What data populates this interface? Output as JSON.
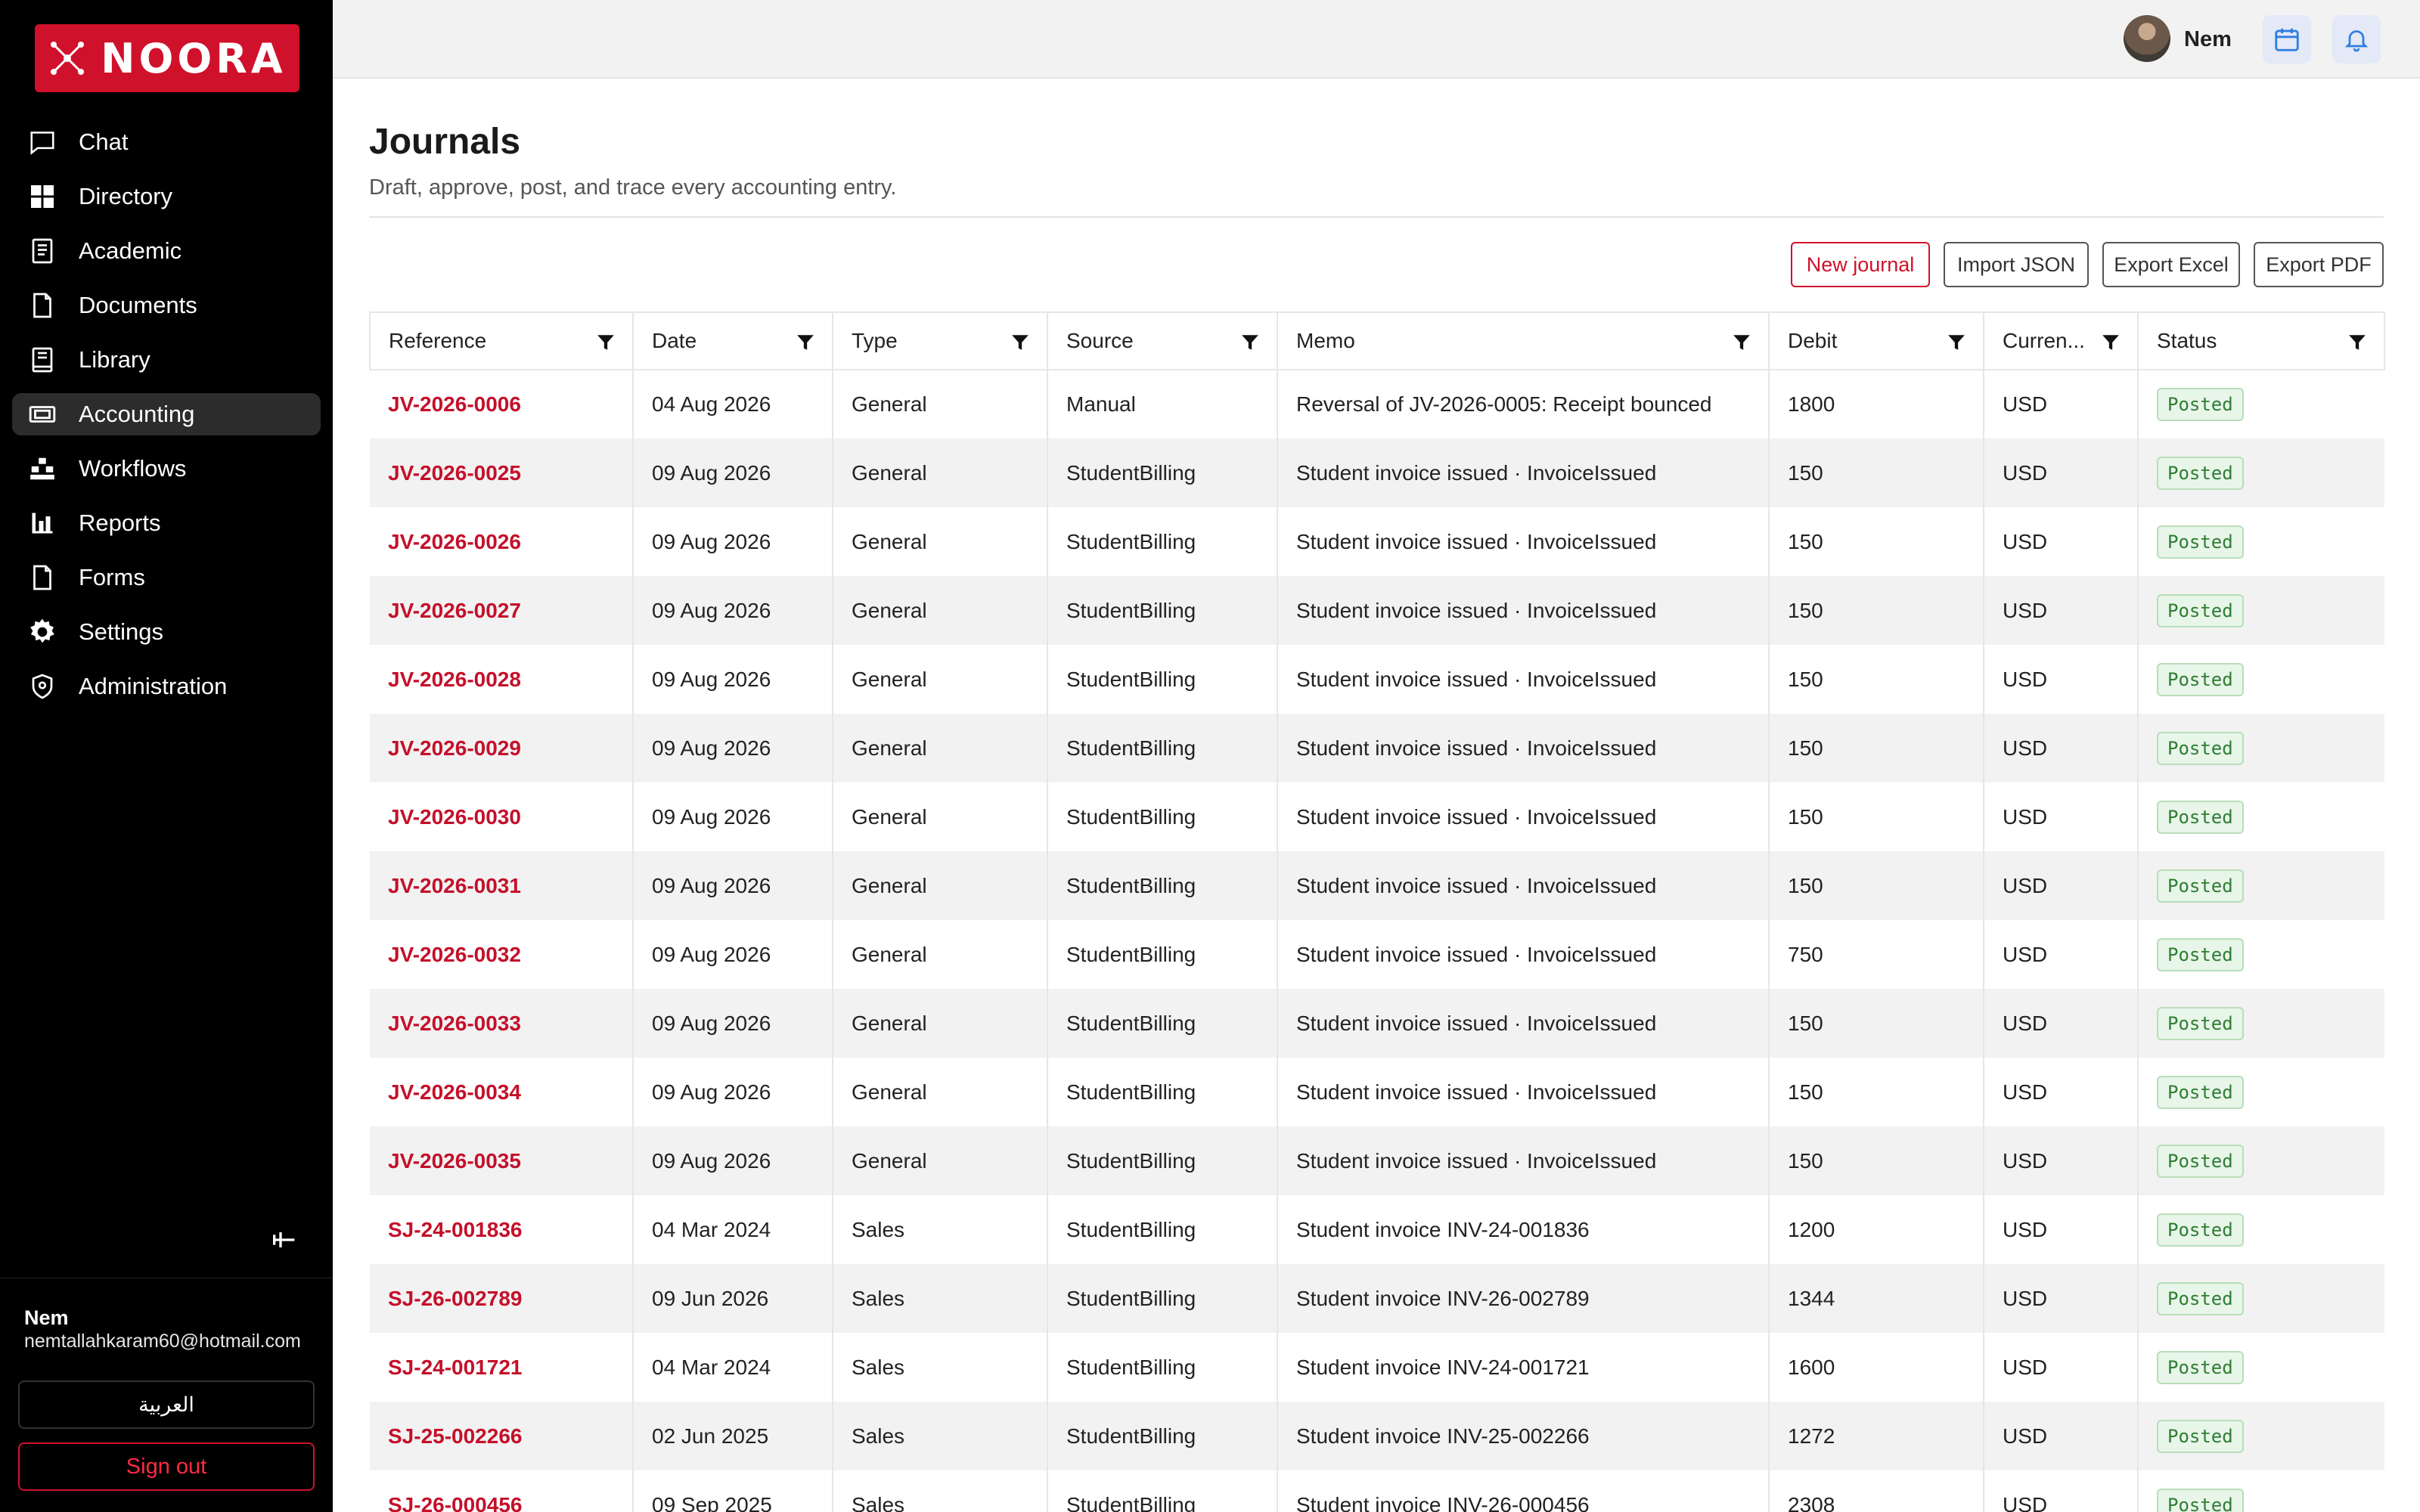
{
  "app": {
    "brand": "NOORA"
  },
  "sidebar": {
    "items": [
      {
        "label": "Chat",
        "icon": "chat-icon"
      },
      {
        "label": "Directory",
        "icon": "grid-icon"
      },
      {
        "label": "Academic",
        "icon": "book-icon"
      },
      {
        "label": "Documents",
        "icon": "document-icon"
      },
      {
        "label": "Library",
        "icon": "library-icon"
      },
      {
        "label": "Accounting",
        "icon": "money-icon",
        "active": true
      },
      {
        "label": "Workflows",
        "icon": "workflow-icon"
      },
      {
        "label": "Reports",
        "icon": "chart-icon"
      },
      {
        "label": "Forms",
        "icon": "form-icon"
      },
      {
        "label": "Settings",
        "icon": "gear-icon"
      },
      {
        "label": "Administration",
        "icon": "shield-icon"
      }
    ],
    "user_name": "Nem",
    "user_email": "nemtallahkaram60@hotmail.com",
    "language_label": "العربية",
    "signout_label": "Sign out"
  },
  "topbar": {
    "user_name": "Nem"
  },
  "page": {
    "title": "Journals",
    "subtitle": "Draft, approve, post, and trace every accounting entry."
  },
  "actions": {
    "new_journal": "New journal",
    "import_json": "Import JSON",
    "export_excel": "Export Excel",
    "export_pdf": "Export PDF"
  },
  "table": {
    "columns": [
      "Reference",
      "Date",
      "Type",
      "Source",
      "Memo",
      "Debit",
      "Curren...",
      "Status"
    ],
    "rows": [
      {
        "reference": "JV-2026-0006",
        "date": "04 Aug 2026",
        "type": "General",
        "source": "Manual",
        "memo": "Reversal of JV-2026-0005: Receipt bounced",
        "debit": "1800",
        "currency": "USD",
        "status": "Posted"
      },
      {
        "reference": "JV-2026-0025",
        "date": "09 Aug 2026",
        "type": "General",
        "source": "StudentBilling",
        "memo": "Student invoice issued · InvoiceIssued",
        "debit": "150",
        "currency": "USD",
        "status": "Posted"
      },
      {
        "reference": "JV-2026-0026",
        "date": "09 Aug 2026",
        "type": "General",
        "source": "StudentBilling",
        "memo": "Student invoice issued · InvoiceIssued",
        "debit": "150",
        "currency": "USD",
        "status": "Posted"
      },
      {
        "reference": "JV-2026-0027",
        "date": "09 Aug 2026",
        "type": "General",
        "source": "StudentBilling",
        "memo": "Student invoice issued · InvoiceIssued",
        "debit": "150",
        "currency": "USD",
        "status": "Posted"
      },
      {
        "reference": "JV-2026-0028",
        "date": "09 Aug 2026",
        "type": "General",
        "source": "StudentBilling",
        "memo": "Student invoice issued · InvoiceIssued",
        "debit": "150",
        "currency": "USD",
        "status": "Posted"
      },
      {
        "reference": "JV-2026-0029",
        "date": "09 Aug 2026",
        "type": "General",
        "source": "StudentBilling",
        "memo": "Student invoice issued · InvoiceIssued",
        "debit": "150",
        "currency": "USD",
        "status": "Posted"
      },
      {
        "reference": "JV-2026-0030",
        "date": "09 Aug 2026",
        "type": "General",
        "source": "StudentBilling",
        "memo": "Student invoice issued · InvoiceIssued",
        "debit": "150",
        "currency": "USD",
        "status": "Posted"
      },
      {
        "reference": "JV-2026-0031",
        "date": "09 Aug 2026",
        "type": "General",
        "source": "StudentBilling",
        "memo": "Student invoice issued · InvoiceIssued",
        "debit": "150",
        "currency": "USD",
        "status": "Posted"
      },
      {
        "reference": "JV-2026-0032",
        "date": "09 Aug 2026",
        "type": "General",
        "source": "StudentBilling",
        "memo": "Student invoice issued · InvoiceIssued",
        "debit": "750",
        "currency": "USD",
        "status": "Posted"
      },
      {
        "reference": "JV-2026-0033",
        "date": "09 Aug 2026",
        "type": "General",
        "source": "StudentBilling",
        "memo": "Student invoice issued · InvoiceIssued",
        "debit": "150",
        "currency": "USD",
        "status": "Posted"
      },
      {
        "reference": "JV-2026-0034",
        "date": "09 Aug 2026",
        "type": "General",
        "source": "StudentBilling",
        "memo": "Student invoice issued · InvoiceIssued",
        "debit": "150",
        "currency": "USD",
        "status": "Posted"
      },
      {
        "reference": "JV-2026-0035",
        "date": "09 Aug 2026",
        "type": "General",
        "source": "StudentBilling",
        "memo": "Student invoice issued · InvoiceIssued",
        "debit": "150",
        "currency": "USD",
        "status": "Posted"
      },
      {
        "reference": "SJ-24-001836",
        "date": "04 Mar 2024",
        "type": "Sales",
        "source": "StudentBilling",
        "memo": "Student invoice INV-24-001836",
        "debit": "1200",
        "currency": "USD",
        "status": "Posted"
      },
      {
        "reference": "SJ-26-002789",
        "date": "09 Jun 2026",
        "type": "Sales",
        "source": "StudentBilling",
        "memo": "Student invoice INV-26-002789",
        "debit": "1344",
        "currency": "USD",
        "status": "Posted"
      },
      {
        "reference": "SJ-24-001721",
        "date": "04 Mar 2024",
        "type": "Sales",
        "source": "StudentBilling",
        "memo": "Student invoice INV-24-001721",
        "debit": "1600",
        "currency": "USD",
        "status": "Posted"
      },
      {
        "reference": "SJ-25-002266",
        "date": "02 Jun 2025",
        "type": "Sales",
        "source": "StudentBilling",
        "memo": "Student invoice INV-25-002266",
        "debit": "1272",
        "currency": "USD",
        "status": "Posted"
      },
      {
        "reference": "SJ-26-000456",
        "date": "09 Sep 2025",
        "type": "Sales",
        "source": "StudentBilling",
        "memo": "Student invoice INV-26-000456",
        "debit": "2308",
        "currency": "USD",
        "status": "Posted"
      }
    ]
  },
  "colors": {
    "brand": "#d0112b",
    "sidebar": "#000000",
    "posted": "#2e7d32"
  }
}
